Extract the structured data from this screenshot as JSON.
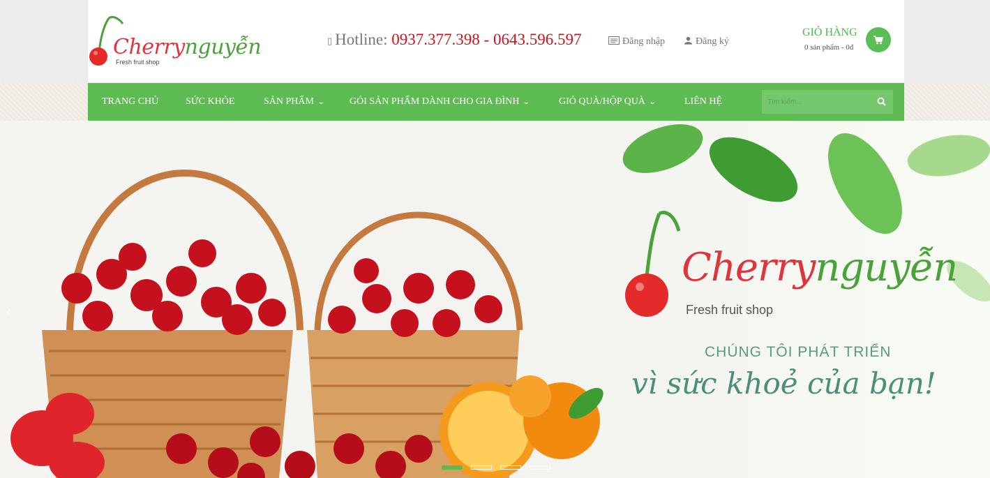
{
  "header": {
    "logo": {
      "brand_red": "Cherry",
      "brand_green": "nguyễn",
      "tagline": "Fresh fruit shop"
    },
    "hotline": {
      "label": "Hotline:",
      "numbers": "0937.377.398 - 0643.596.597",
      "icon": "mobile-phone-icon"
    },
    "login_label": "Đăng nhập",
    "register_label": "Đăng ký",
    "cart": {
      "title": "GIỎ HÀNG",
      "summary": "0 sản phẩm - 0đ",
      "icon": "shopping-cart-icon"
    }
  },
  "nav": {
    "items": [
      {
        "label": "TRANG CHỦ",
        "dropdown": false
      },
      {
        "label": "SỨC KHỎE",
        "dropdown": false
      },
      {
        "label": "SẢN PHẨM",
        "dropdown": true
      },
      {
        "label": "GÓI SẢN PHẨM DÀNH CHO GIA ĐÌNH",
        "dropdown": true
      },
      {
        "label": "GIỎ QUÀ/HỘP QUÀ",
        "dropdown": true
      },
      {
        "label": "LIÊN HỆ",
        "dropdown": false
      }
    ],
    "search": {
      "placeholder": "Tìm kiếm...",
      "icon": "search-icon"
    }
  },
  "banner": {
    "brand_red": "Cherry",
    "brand_green": "nguyễn",
    "tagline": "Fresh fruit shop",
    "headline_1": "CHÚNG TÔI PHÁT TRIỂN",
    "headline_2": "vì sức khoẻ của bạn!",
    "slide_count": 4,
    "active_slide": 1
  },
  "colors": {
    "primary_green": "#5cbb51",
    "hotline_red": "#d0111a",
    "brand_red": "#e0333b"
  }
}
